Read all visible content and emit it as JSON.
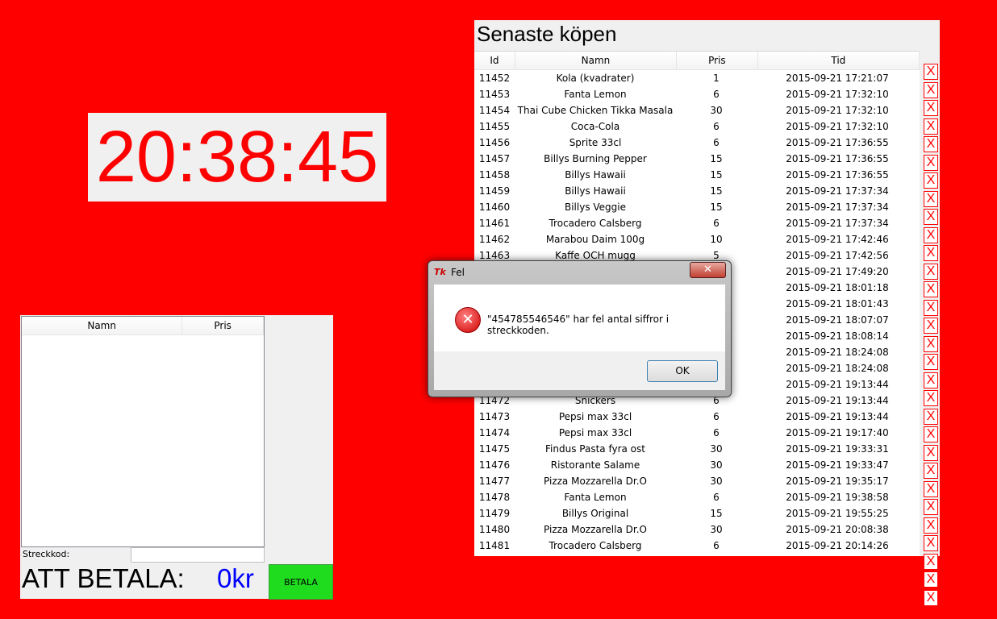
{
  "clock": {
    "time": "20:38:45"
  },
  "cart": {
    "columns": [
      "Namn",
      "Pris"
    ],
    "barcode_label": "Streckkod:",
    "barcode_value": "",
    "total_label": "ATT BETALA:",
    "total_amount": "0kr",
    "pay_label": "BETALA"
  },
  "recent": {
    "title": "Senaste köpen",
    "columns": [
      "Id",
      "Namn",
      "Pris",
      "Tid"
    ],
    "rows": [
      {
        "id": "11452",
        "name": "Kola (kvadrater)",
        "price": "1",
        "time": "2015-09-21 17:21:07"
      },
      {
        "id": "11453",
        "name": "Fanta Lemon",
        "price": "6",
        "time": "2015-09-21 17:32:10"
      },
      {
        "id": "11454",
        "name": "Thai Cube Chicken Tikka Masala",
        "price": "30",
        "time": "2015-09-21 17:32:10"
      },
      {
        "id": "11455",
        "name": "Coca-Cola",
        "price": "6",
        "time": "2015-09-21 17:32:10"
      },
      {
        "id": "11456",
        "name": "Sprite 33cl",
        "price": "6",
        "time": "2015-09-21 17:36:55"
      },
      {
        "id": "11457",
        "name": "Billys Burning Pepper",
        "price": "15",
        "time": "2015-09-21 17:36:55"
      },
      {
        "id": "11458",
        "name": "Billys Hawaii",
        "price": "15",
        "time": "2015-09-21 17:36:55"
      },
      {
        "id": "11459",
        "name": "Billys Hawaii",
        "price": "15",
        "time": "2015-09-21 17:37:34"
      },
      {
        "id": "11460",
        "name": "Billys Veggie",
        "price": "15",
        "time": "2015-09-21 17:37:34"
      },
      {
        "id": "11461",
        "name": "Trocadero Calsberg",
        "price": "6",
        "time": "2015-09-21 17:37:34"
      },
      {
        "id": "11462",
        "name": "Marabou Daim 100g",
        "price": "10",
        "time": "2015-09-21 17:42:46"
      },
      {
        "id": "11463",
        "name": "Kaffe OCH mugg",
        "price": "5",
        "time": "2015-09-21 17:42:56"
      },
      {
        "id": "",
        "name": "",
        "price": "",
        "time": "2015-09-21 17:49:20"
      },
      {
        "id": "",
        "name": "",
        "price": "",
        "time": "2015-09-21 18:01:18"
      },
      {
        "id": "",
        "name": "",
        "price": "",
        "time": "2015-09-21 18:01:43"
      },
      {
        "id": "",
        "name": "",
        "price": "",
        "time": "2015-09-21 18:07:07"
      },
      {
        "id": "",
        "name": "",
        "price": "",
        "time": "2015-09-21 18:08:14"
      },
      {
        "id": "",
        "name": "",
        "price": "",
        "time": "2015-09-21 18:24:08"
      },
      {
        "id": "",
        "name": "",
        "price": "",
        "time": "2015-09-21 18:24:08"
      },
      {
        "id": "",
        "name": "",
        "price": "",
        "time": "2015-09-21 19:13:44"
      },
      {
        "id": "11472",
        "name": "Snickers",
        "price": "6",
        "time": "2015-09-21 19:13:44"
      },
      {
        "id": "11473",
        "name": "Pepsi max 33cl",
        "price": "6",
        "time": "2015-09-21 19:13:44"
      },
      {
        "id": "11474",
        "name": "Pepsi max 33cl",
        "price": "6",
        "time": "2015-09-21 19:17:40"
      },
      {
        "id": "11475",
        "name": "Findus Pasta fyra ost",
        "price": "30",
        "time": "2015-09-21 19:33:31"
      },
      {
        "id": "11476",
        "name": "Ristorante Salame",
        "price": "30",
        "time": "2015-09-21 19:33:47"
      },
      {
        "id": "11477",
        "name": "Pizza Mozzarella Dr.O",
        "price": "30",
        "time": "2015-09-21 19:35:17"
      },
      {
        "id": "11478",
        "name": "Fanta Lemon",
        "price": "6",
        "time": "2015-09-21 19:38:58"
      },
      {
        "id": "11479",
        "name": "Billys Original",
        "price": "15",
        "time": "2015-09-21 19:55:25"
      },
      {
        "id": "11480",
        "name": "Pizza Mozzarella Dr.O",
        "price": "30",
        "time": "2015-09-21 20:08:38"
      },
      {
        "id": "11481",
        "name": "Trocadero Calsberg",
        "price": "6",
        "time": "2015-09-21 20:14:26"
      }
    ],
    "delete_label": "X"
  },
  "dialog": {
    "app_icon": "Tk",
    "title": "Fel",
    "close_label": "✕",
    "message": "\"454785546546\" har fel antal siffror i streckkoden.",
    "error_icon": "✕",
    "ok_label": "OK"
  }
}
